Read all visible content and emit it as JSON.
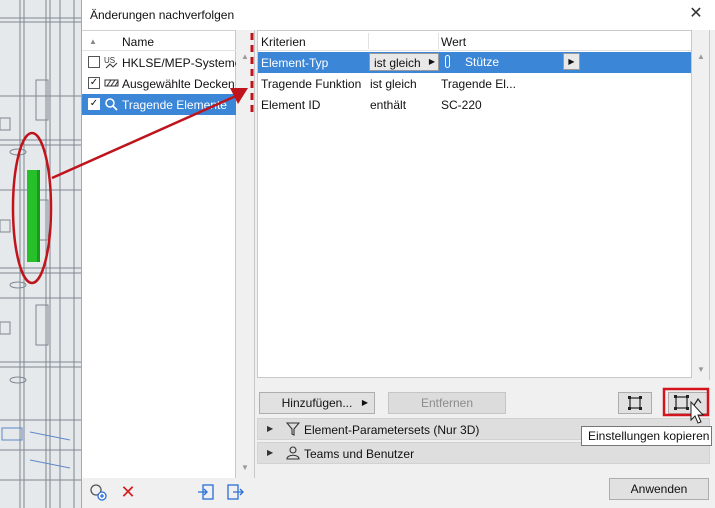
{
  "window": {
    "title": "Änderungen nachverfolgen",
    "close_label": "✕"
  },
  "left_list": {
    "header": "Name",
    "items": [
      {
        "label": "HKLSE/MEP-Systeme",
        "checked": false,
        "icon": "mep-system-icon"
      },
      {
        "label": "Ausgewählte Decken",
        "checked": true,
        "icon": "slab-hatch-icon"
      },
      {
        "label": "Tragende Elemente",
        "checked": true,
        "icon": "search-magnifier-icon",
        "selected": true
      }
    ]
  },
  "criteria_table": {
    "columns": [
      "Kriterien",
      "Wert"
    ],
    "rows": [
      {
        "criterion": "Element-Typ",
        "operator": "ist gleich",
        "value": "Stütze",
        "selected": true
      },
      {
        "criterion": "Tragende Funktion",
        "operator": "ist gleich",
        "value": "Tragende El..."
      },
      {
        "criterion": "Element ID",
        "operator": "enthält",
        "value": "SC-220"
      }
    ]
  },
  "buttons": {
    "add": "Hinzufügen...",
    "remove": "Entfernen",
    "apply": "Anwenden"
  },
  "sections": [
    {
      "label": "Element-Parametersets (Nur 3D)",
      "icon": "filter-icon"
    },
    {
      "label": "Teams und Benutzer",
      "icon": "user-icon"
    }
  ],
  "tooltip": "Einstellungen kopieren",
  "colors": {
    "selection": "#3b86d6",
    "annotation_red": "#c0141c",
    "column_green": "#27c02a"
  }
}
